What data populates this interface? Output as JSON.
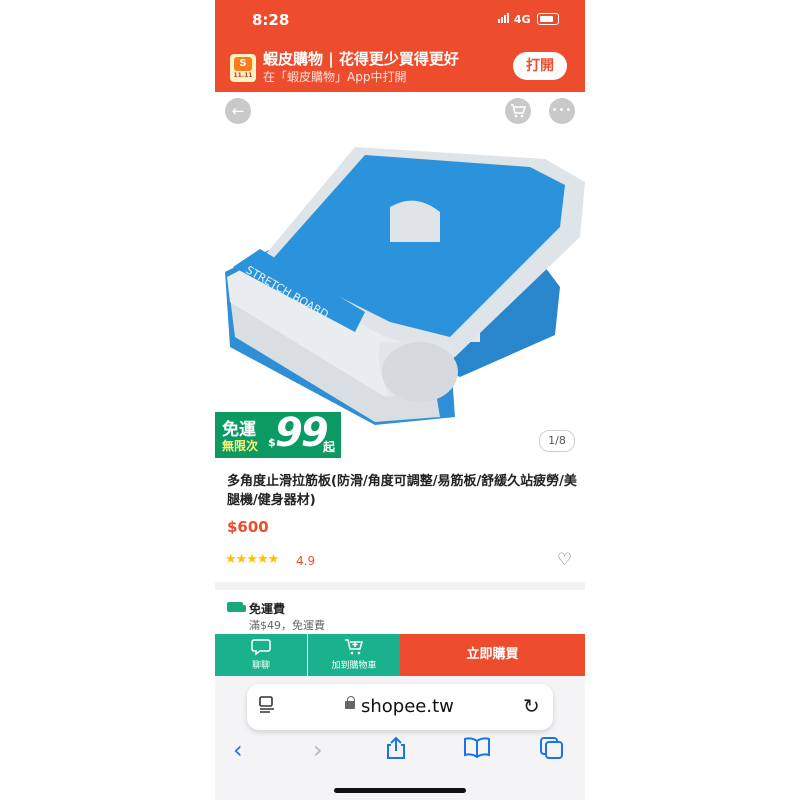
{
  "status": {
    "time": "8:28",
    "network": "4G"
  },
  "banner": {
    "logo_label": "11.11",
    "logo_glyph": "S",
    "title": "蝦皮購物 | 花得更少買得更好",
    "subtitle": "在「蝦皮購物」App中打開",
    "open_label": "打開"
  },
  "gallery": {
    "promo_free": "免運",
    "promo_unlimited": "無限次",
    "promo_dollar": "$",
    "promo_amount": "99",
    "promo_up": "起",
    "page_indicator": "1/8",
    "board_text": "STRETCH BOARD"
  },
  "product": {
    "title": "多角度止滑拉筋板(防滑/角度可調整/易筋板/舒緩久站疲勞/美腿機/健身器材)",
    "price": "$600",
    "stars": "★★★★★",
    "rating": "4.9"
  },
  "shipping": {
    "title": "免運費",
    "subtitle": "滿$49，免運費"
  },
  "actions": {
    "chat_label": "聊聊",
    "add_cart_label": "加到購物車",
    "buy_label": "立即購買"
  },
  "browser": {
    "url": "shopee.tw"
  },
  "colors": {
    "brand": "#ee4d2d",
    "accent_green": "#19b28c",
    "link_blue": "#1a73e8"
  },
  "icons": [
    "back-arrow-icon",
    "cart-icon",
    "more-icon",
    "heart-icon",
    "truck-icon",
    "chat-icon",
    "add-cart-icon",
    "reader-icon",
    "lock-icon",
    "reload-icon",
    "share-icon",
    "bookmarks-icon",
    "tabs-icon"
  ]
}
